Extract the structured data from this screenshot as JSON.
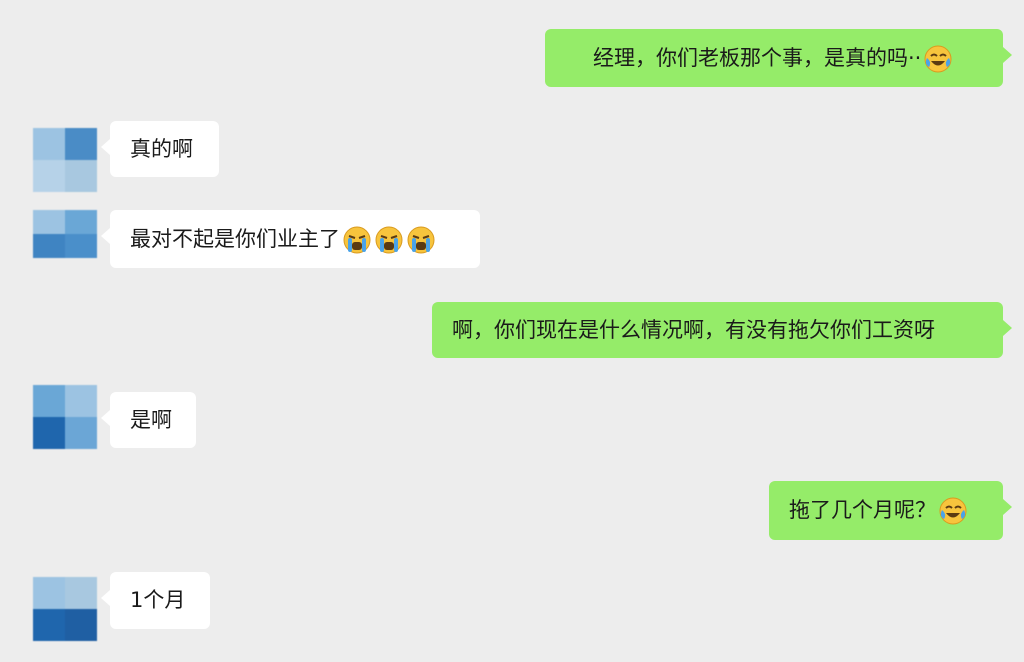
{
  "colors": {
    "background": "#ededed",
    "outgoing_bubble": "#95ec69",
    "incoming_bubble": "#ffffff",
    "text": "#1a1a1a"
  },
  "messages": [
    {
      "direction": "outgoing",
      "text": "经理，你们老板那个事，是真的吗··",
      "emoji": [
        "laugh-cry"
      ]
    },
    {
      "direction": "incoming",
      "text": "真的啊",
      "emoji": []
    },
    {
      "direction": "incoming",
      "text": "最对不起是你们业主了",
      "emoji": [
        "loud-cry",
        "loud-cry",
        "loud-cry"
      ]
    },
    {
      "direction": "outgoing",
      "text": "啊，你们现在是什么情况啊，有没有拖欠你们工资呀",
      "emoji": []
    },
    {
      "direction": "incoming",
      "text": "是啊",
      "emoji": []
    },
    {
      "direction": "outgoing",
      "text": "拖了几个月呢？",
      "emoji": [
        "laugh-cry"
      ]
    },
    {
      "direction": "incoming",
      "text": "1个月",
      "emoji": []
    }
  ]
}
